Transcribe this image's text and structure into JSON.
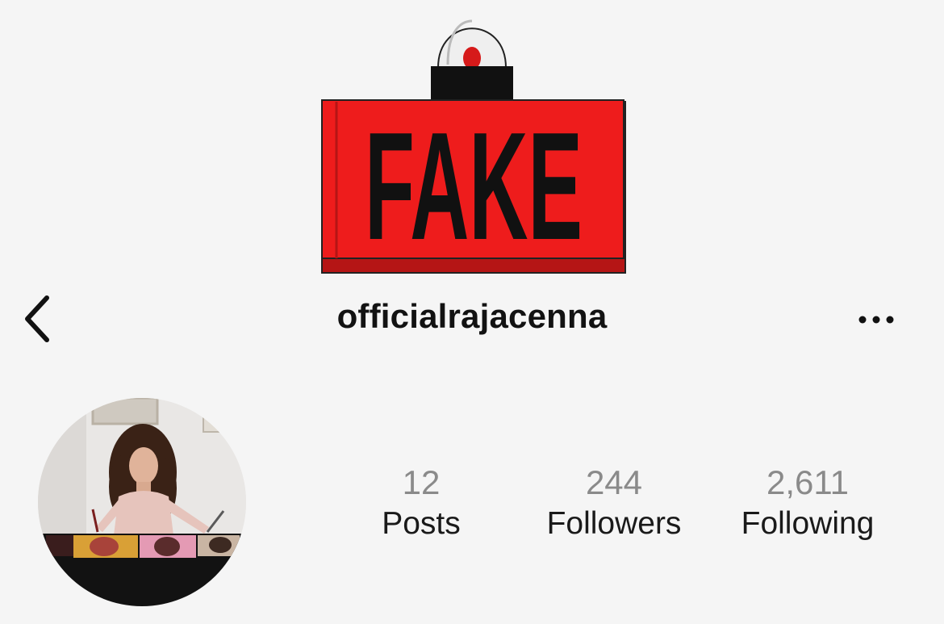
{
  "overlay": {
    "badge_text": "FAKE",
    "badge_color": "#ee1c1c",
    "icon": "alarm-siren-icon"
  },
  "header": {
    "username": "officialrajacenna",
    "back_icon": "chevron-left-icon",
    "more_icon": "more-horizontal-icon"
  },
  "profile": {
    "avatar_icon": "profile-avatar"
  },
  "stats": {
    "posts": {
      "count": "12",
      "label": "Posts"
    },
    "followers": {
      "count": "244",
      "label": "Followers"
    },
    "following": {
      "count": "2,611",
      "label": "Following"
    }
  }
}
